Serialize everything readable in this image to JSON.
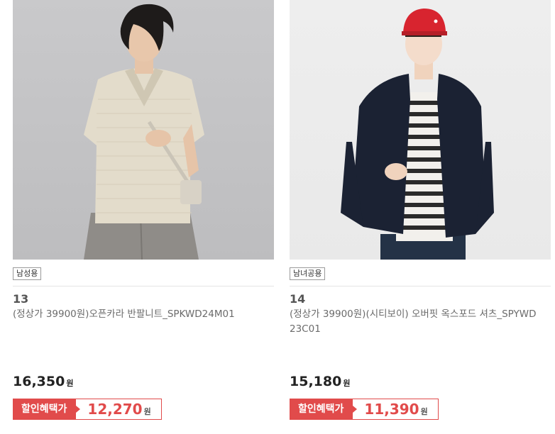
{
  "products": [
    {
      "tag": "남성용",
      "number": "13",
      "title": "(정상가 39900원)오픈카라 반팔니트_SPKWD24M01",
      "price": "16,350",
      "price_unit": "원",
      "benefit_label": "할인혜택가",
      "benefit_price": "12,270",
      "benefit_unit": "원",
      "image": "model-beige-knit-polo"
    },
    {
      "tag": "남녀공용",
      "number": "14",
      "title": "(정상가 39900원)(시티보이) 오버핏 옥스포드 셔츠_SPYWD23C01",
      "price": "15,180",
      "price_unit": "원",
      "benefit_label": "할인혜택가",
      "benefit_price": "11,390",
      "benefit_unit": "원",
      "image": "model-navy-oxford-shirt-red-cap"
    }
  ],
  "colors": {
    "accent": "#e14b4b",
    "text_muted": "#6b6b6b"
  }
}
